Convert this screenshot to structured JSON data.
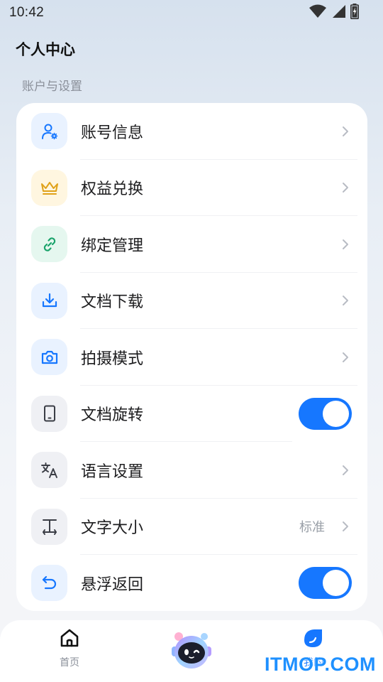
{
  "status_bar": {
    "time": "10:42",
    "icons": [
      "wifi-icon",
      "signal-icon",
      "battery-charging-icon"
    ]
  },
  "header": {
    "title": "个人中心"
  },
  "section": {
    "label": "账户与设置"
  },
  "menu": [
    {
      "label": "账号信息",
      "icon": "user-settings-icon",
      "control": "chevron"
    },
    {
      "label": "权益兑换",
      "icon": "crown-icon",
      "control": "chevron"
    },
    {
      "label": "绑定管理",
      "icon": "link-icon",
      "control": "chevron"
    },
    {
      "label": "文档下载",
      "icon": "download-icon",
      "control": "chevron"
    },
    {
      "label": "拍摄模式",
      "icon": "camera-icon",
      "control": "chevron"
    },
    {
      "label": "文档旋转",
      "icon": "phone-rotate-icon",
      "control": "toggle",
      "toggle_on": true
    },
    {
      "label": "语言设置",
      "icon": "translate-icon",
      "control": "chevron"
    },
    {
      "label": "文字大小",
      "icon": "text-size-icon",
      "control": "chevron",
      "value": "标准"
    },
    {
      "label": "悬浮返回",
      "icon": "undo-icon",
      "control": "toggle",
      "toggle_on": true
    }
  ],
  "tab_bar": {
    "home_label": "首页",
    "mine_label": "我的"
  },
  "watermark": "ITMOP.COM",
  "colors": {
    "accent": "#1677ff",
    "crown": "#e0a21a",
    "link": "#1aa36b",
    "gray_icon": "#3a3d45"
  }
}
